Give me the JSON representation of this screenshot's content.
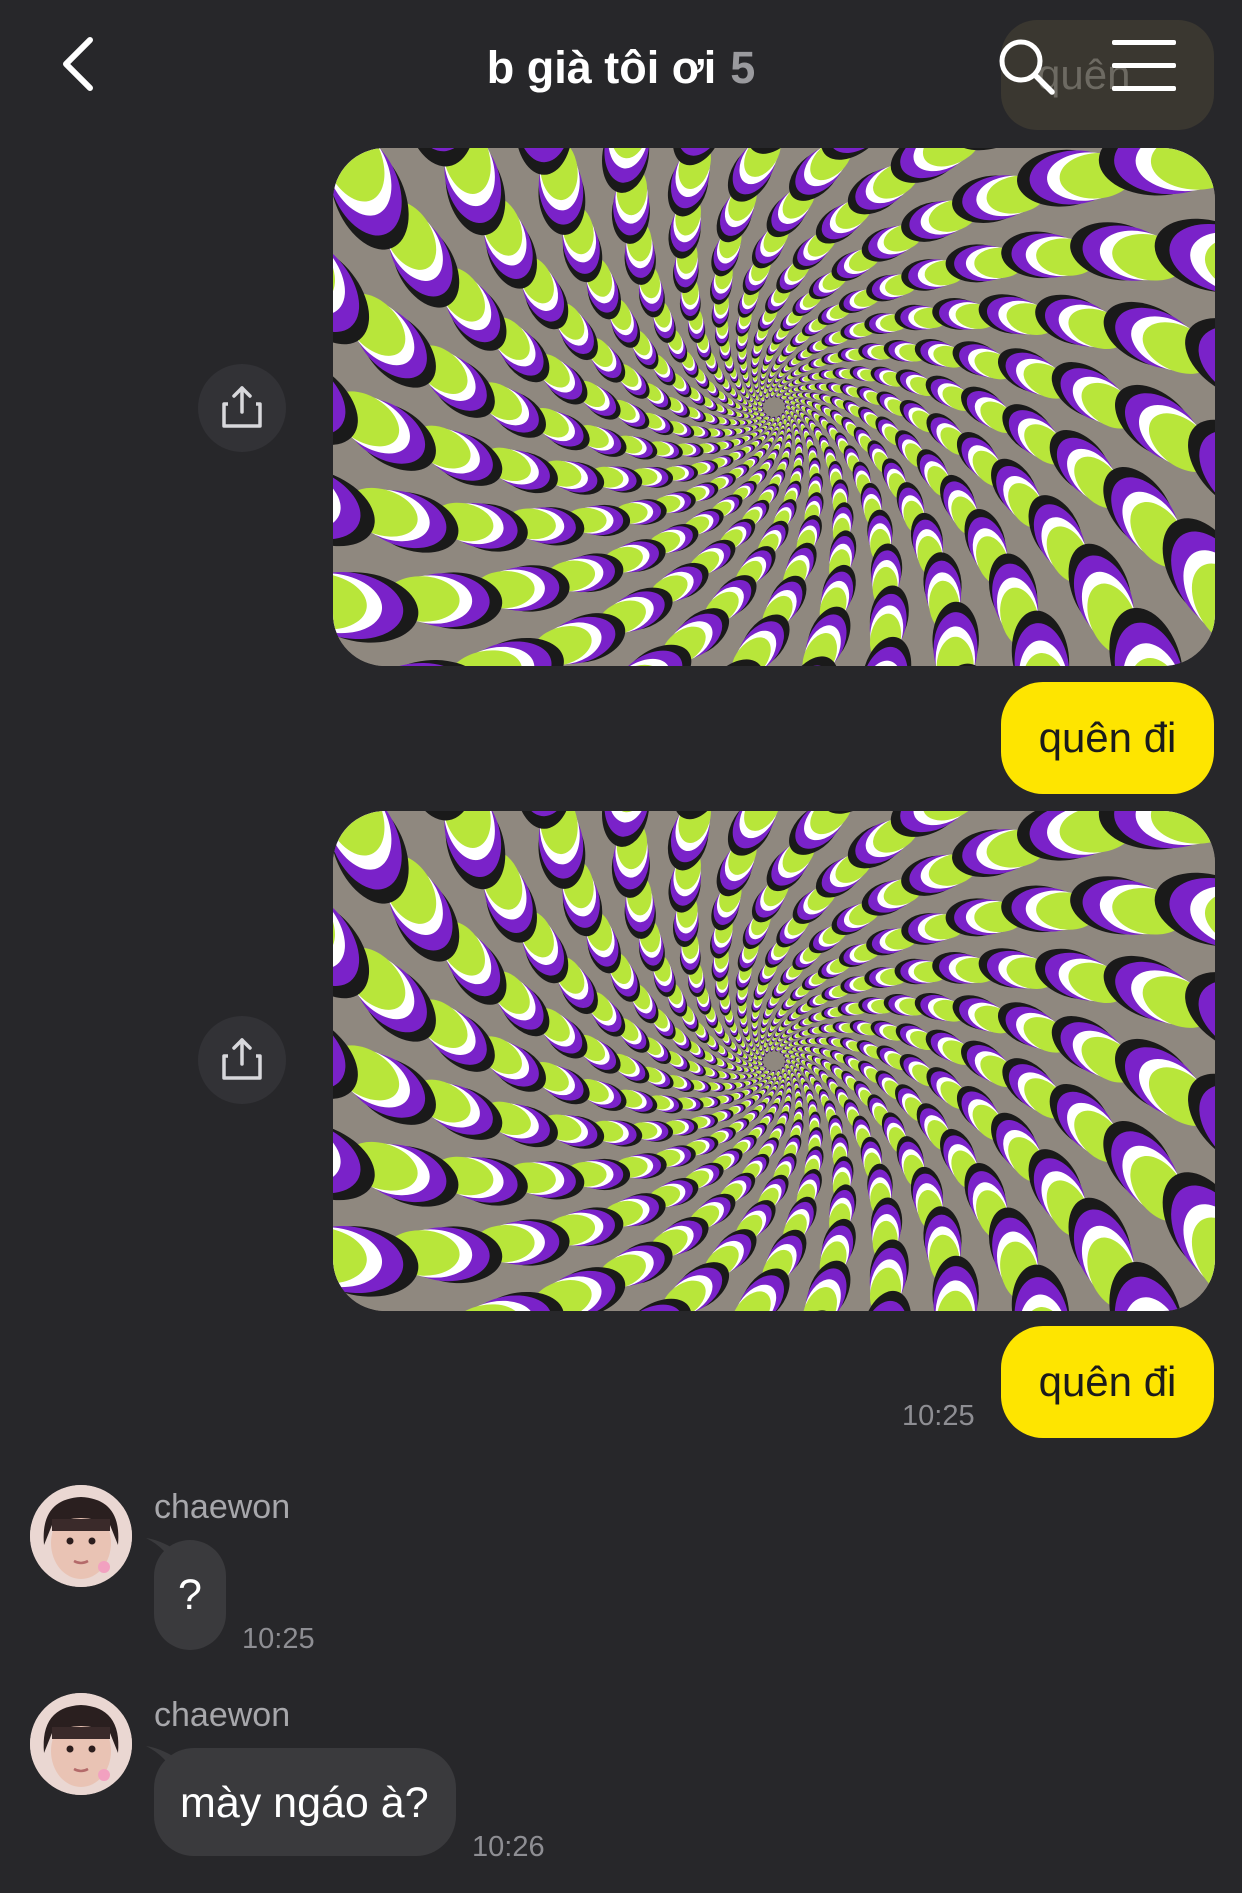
{
  "header": {
    "title": "b già tôi ơi",
    "member_count": "5",
    "ghost_bubble_text": "quên",
    "icons": [
      "back-chevron-icon",
      "search-icon",
      "menu-icon"
    ]
  },
  "messages": [
    {
      "type": "image",
      "from": "me",
      "share_icon": "share-icon"
    },
    {
      "type": "text",
      "from": "me",
      "text": "quên đi"
    },
    {
      "type": "image",
      "from": "me",
      "share_icon": "share-icon"
    },
    {
      "type": "text",
      "from": "me",
      "text": "quên đi",
      "time": "10:25"
    },
    {
      "type": "text",
      "from": "chaewon",
      "sender": "chaewon",
      "text": "?",
      "time": "10:25"
    },
    {
      "type": "text",
      "from": "chaewon",
      "sender": "chaewon",
      "text": "mày ngáo à?",
      "time": "10:26"
    }
  ],
  "colors": {
    "background": "#27272a",
    "my_bubble": "#fee500",
    "their_bubble": "#3a3a3d",
    "time_text": "#8e8e93",
    "illusion_green": "#b8e63a",
    "illusion_purple": "#7a22c9"
  }
}
